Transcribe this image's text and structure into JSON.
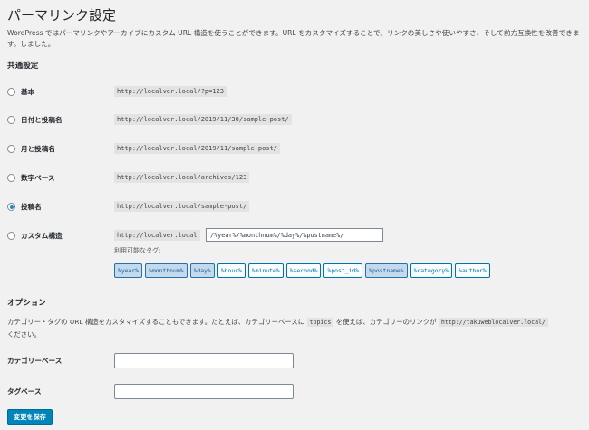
{
  "page": {
    "title": "パーマリンク設定",
    "intro": "WordPress ではパーマリンクやアーカイブにカスタム URL 構造を使うことができます。URL をカスタマイズすることで、リンクの美しさや使いやすさ、そして前方互換性を改善できます。しました。"
  },
  "common": {
    "heading": "共通設定",
    "options": [
      {
        "label": "基本",
        "example": "http://localver.local/?p=123",
        "checked": false
      },
      {
        "label": "日付と投稿名",
        "example": "http://localver.local/2019/11/30/sample-post/",
        "checked": false
      },
      {
        "label": "月と投稿名",
        "example": "http://localver.local/2019/11/sample-post/",
        "checked": false
      },
      {
        "label": "数字ベース",
        "example": "http://localver.local/archives/123",
        "checked": false
      },
      {
        "label": "投稿名",
        "example": "http://localver.local/sample-post/",
        "checked": true
      },
      {
        "label": "カスタム構造",
        "example": "http://localver.local",
        "checked": false
      }
    ],
    "custom_structure_value": "/%year%/%monthnum%/%day%/%postname%/",
    "available_tags_label": "利用可能なタグ:",
    "tags": [
      {
        "label": "%year%",
        "pressed": true
      },
      {
        "label": "%monthnum%",
        "pressed": true
      },
      {
        "label": "%day%",
        "pressed": true
      },
      {
        "label": "%hour%",
        "pressed": false
      },
      {
        "label": "%minute%",
        "pressed": false
      },
      {
        "label": "%second%",
        "pressed": false
      },
      {
        "label": "%post_id%",
        "pressed": false
      },
      {
        "label": "%postname%",
        "pressed": true
      },
      {
        "label": "%category%",
        "pressed": false
      },
      {
        "label": "%author%",
        "pressed": false
      }
    ]
  },
  "optional": {
    "heading": "オプション",
    "desc_part1": "カテゴリー・タグの URL 構造をカスタマイズすることもできます。たとえば、カテゴリーベースに ",
    "desc_code1": "topics",
    "desc_part2": " を使えば、カテゴリーのリンクが ",
    "desc_code2": "http://takuweblocalver.local/",
    "desc_part3": "ください。",
    "category_base_label": "カテゴリーベース",
    "category_base_value": "",
    "tag_base_label": "タグベース",
    "tag_base_value": ""
  },
  "submit_label": "変更を保存",
  "colors": {
    "accent": "#0085ba",
    "link": "#0073aa",
    "background": "#f1f1f1"
  }
}
